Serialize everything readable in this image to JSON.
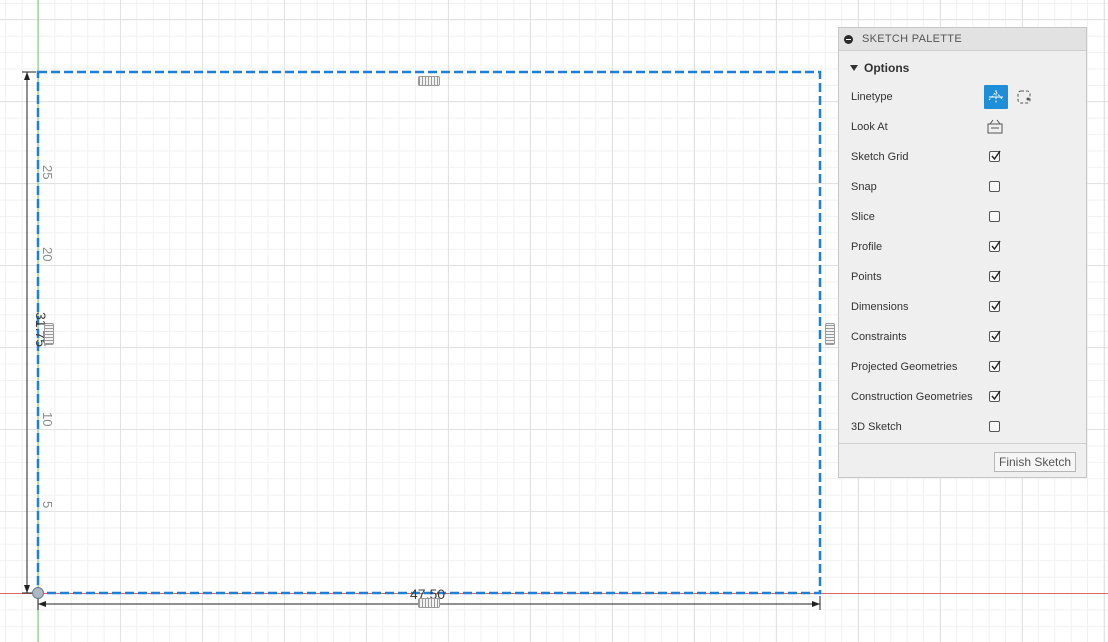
{
  "palette": {
    "title": "SKETCH PALETTE",
    "options_label": "Options",
    "rows": [
      {
        "label": "Linetype",
        "control": "linetype"
      },
      {
        "label": "Look At",
        "control": "look-at"
      },
      {
        "label": "Sketch Grid",
        "checked": true
      },
      {
        "label": "Snap",
        "checked": false
      },
      {
        "label": "Slice",
        "checked": false
      },
      {
        "label": "Profile",
        "checked": true
      },
      {
        "label": "Points",
        "checked": true
      },
      {
        "label": "Dimensions",
        "checked": true
      },
      {
        "label": "Constraints",
        "checked": true
      },
      {
        "label": "Projected Geometries",
        "checked": true
      },
      {
        "label": "Construction Geometries",
        "checked": true
      },
      {
        "label": "3D Sketch",
        "checked": false
      }
    ],
    "finish_button": "Finish Sketch"
  },
  "canvas": {
    "y_axis_ticks": [
      "25",
      "20",
      "15",
      "10",
      "5"
    ],
    "dimension_horizontal": "47.50",
    "dimension_vertical": "31.75"
  },
  "colors": {
    "sketch_line": "#1e7fd9",
    "x_axis": "#e06666",
    "y_axis": "#6fcf6f",
    "accent": "#1f8ed8"
  },
  "icons": {
    "collapse": "minus-circle-icon",
    "options_toggle": "triangle-down-icon",
    "linetype_normal": "linetype-normal-icon",
    "linetype_construction": "linetype-construction-icon",
    "look_at": "look-at-icon"
  }
}
